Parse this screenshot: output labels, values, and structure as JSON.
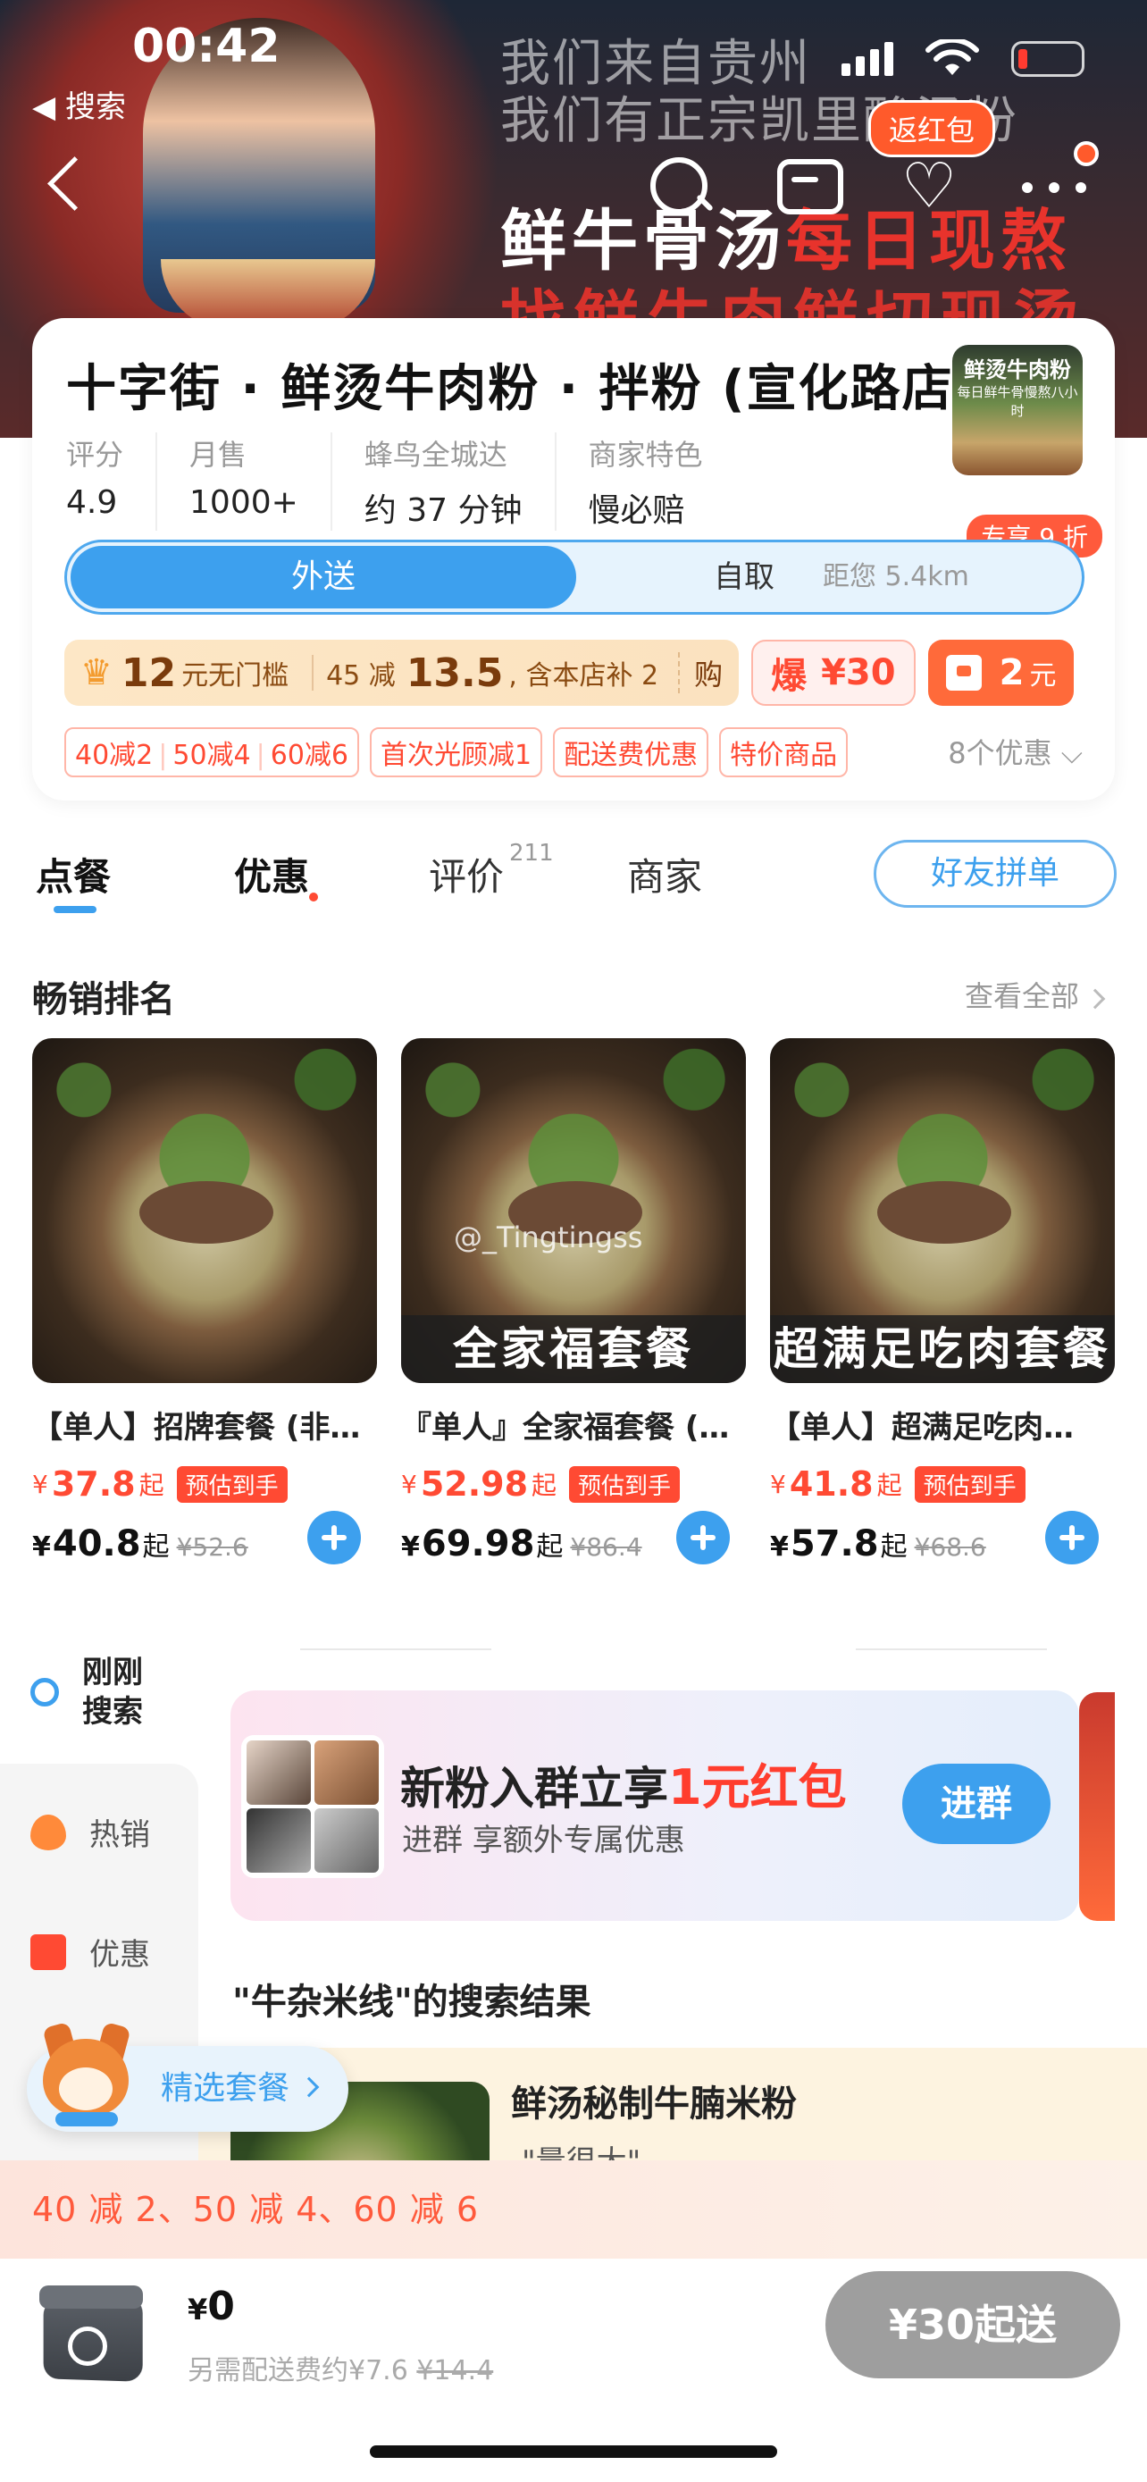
{
  "status_bar": {
    "time": "00:42",
    "back_app": "◀ 搜索"
  },
  "hero": {
    "slogan_line1": "我们来自贵州",
    "slogan_line2": "我们有正宗凯里酸汤粉",
    "banner_line1_a": "鲜牛骨汤",
    "banner_line1_b": "每日现熬",
    "banner_line2": "找鲜牛肉鲜切现烫",
    "return_redpacket": "返红包"
  },
  "shop": {
    "name": "十字街 · 鲜烫牛肉粉 · 拌粉 (宣化路店)",
    "logo_title": "鲜烫牛肉粉",
    "logo_sub": "每日鲜牛骨慢熬八小时",
    "stats": [
      {
        "label": "评分",
        "value": "4.9"
      },
      {
        "label": "月售",
        "value": "1000+"
      },
      {
        "label": "蜂鸟全城达",
        "value": "约 37 分钟"
      },
      {
        "label": "商家特色",
        "value": "慢必赔"
      }
    ],
    "mode_delivery": "外送",
    "mode_pickup": "自取",
    "distance": "距您 5.4km",
    "exclusive_badge": "专享 9 折",
    "coupon": {
      "amount": "12",
      "amount_unit": "元无门槛",
      "discount": "45 减",
      "discount_value": "13.5",
      "discount_note": ", 含本店补 2",
      "buy": "购",
      "boom_label": "爆",
      "boom_value": "¥30",
      "redpacket_value": "2",
      "redpacket_unit": "元"
    },
    "promos": [
      "首次光顾减1",
      "配送费优惠",
      "特价商品"
    ],
    "tier_promo": [
      "40减2",
      "50减4",
      "60减6"
    ],
    "promo_more": "8个优惠 ⌵"
  },
  "tabs": {
    "order": "点餐",
    "deals": "优惠",
    "reviews": "评价",
    "review_count": "211",
    "merchant": "商家",
    "group_btn": "好友拼单"
  },
  "bestsellers": {
    "title": "畅销排名",
    "see_all": "查看全部",
    "watermark": "@_Tingtingss",
    "items": [
      {
        "name": "【单人】招牌套餐 (非…",
        "price": "37.8",
        "orig": "40.8",
        "strike": "¥52.6",
        "overlay": "",
        "est": "预估到手",
        "qi": "起",
        "yen": "¥"
      },
      {
        "name": "『单人』全家福套餐 (…",
        "price": "52.98",
        "orig": "69.98",
        "strike": "¥86.4",
        "overlay": "全家福套餐",
        "est": "预估到手",
        "qi": "起",
        "yen": "¥"
      },
      {
        "name": "【单人】超满足吃肉…",
        "price": "41.8",
        "orig": "57.8",
        "strike": "¥68.6",
        "overlay": "超满足吃肉套餐",
        "est": "预估到手",
        "qi": "起",
        "yen": "¥"
      }
    ]
  },
  "sidebar": {
    "items": [
      {
        "label": "刚刚搜索"
      },
      {
        "label": "热销"
      },
      {
        "label": "优惠"
      }
    ]
  },
  "join_group": {
    "title_a": "新粉入群立享",
    "title_red": "1元红包",
    "subtitle": "进群  享额外专属优惠",
    "button": "进群"
  },
  "results": {
    "title": "\"牛杂米线\"的搜索结果",
    "first_name": "鲜汤秘制牛腩米粉",
    "first_quote": "\"量很大\""
  },
  "featured_pill": "精选套餐",
  "discount_strip": "40 减 2、50 减 4、60 减 6",
  "cart": {
    "amount_yen": "¥",
    "amount": "0",
    "fee_text": "另需配送费约¥7.6",
    "fee_orig": "¥14.4",
    "checkout": "¥30起送"
  }
}
